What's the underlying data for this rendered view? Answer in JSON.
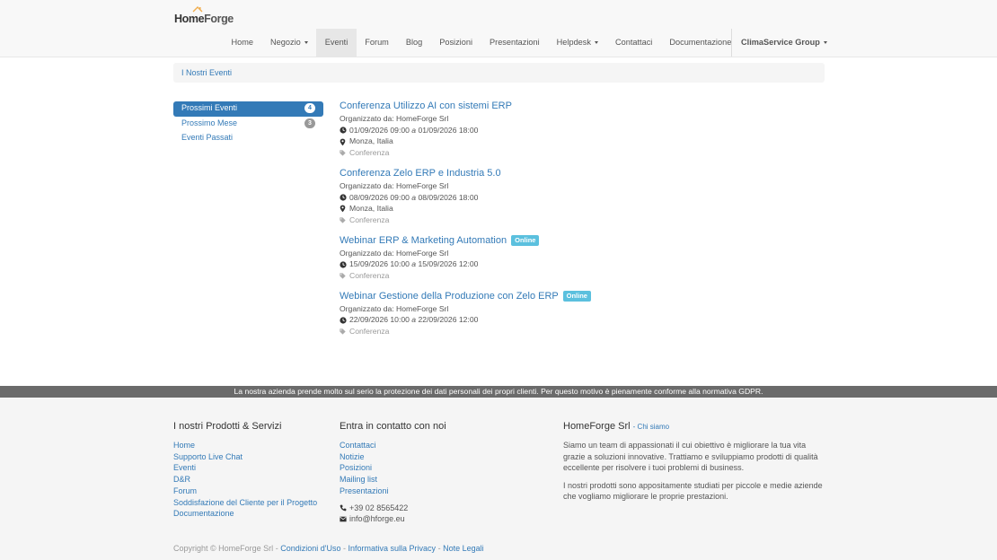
{
  "header": {
    "brand": {
      "home": "Home",
      "forge": "Forge"
    },
    "nav": [
      {
        "label": "Home",
        "dropdown": false,
        "active": false
      },
      {
        "label": "Negozio",
        "dropdown": true,
        "active": false
      },
      {
        "label": "Eventi",
        "dropdown": false,
        "active": true
      },
      {
        "label": "Forum",
        "dropdown": false,
        "active": false
      },
      {
        "label": "Blog",
        "dropdown": false,
        "active": false
      },
      {
        "label": "Posizioni",
        "dropdown": false,
        "active": false
      },
      {
        "label": "Presentazioni",
        "dropdown": false,
        "active": false
      },
      {
        "label": "Helpdesk",
        "dropdown": true,
        "active": false
      },
      {
        "label": "Contattaci",
        "dropdown": false,
        "active": false
      },
      {
        "label": "Documentazione",
        "dropdown": false,
        "active": false
      }
    ],
    "company": "ClimaService Group"
  },
  "breadcrumb": "I Nostri Eventi",
  "sidebar": [
    {
      "label": "Prossimi Eventi",
      "count": "4",
      "active": true
    },
    {
      "label": "Prossimo Mese",
      "count": "3",
      "active": false
    },
    {
      "label": "Eventi Passati",
      "count": "",
      "active": false
    }
  ],
  "events": [
    {
      "title": "Conferenza Utilizzo AI con sistemi ERP",
      "online": false,
      "organizer": "Organizzato da: HomeForge Srl",
      "start": "01/09/2026 09:00",
      "end": "01/09/2026 18:00",
      "location": "Monza, Italia",
      "tag": "Conferenza"
    },
    {
      "title": "Conferenza Zelo ERP e Industria 5.0",
      "online": false,
      "organizer": "Organizzato da: HomeForge Srl",
      "start": "08/09/2026 09:00",
      "end": "08/09/2026 18:00",
      "location": "Monza, Italia",
      "tag": "Conferenza"
    },
    {
      "title": "Webinar ERP & Marketing Automation",
      "online": true,
      "organizer": "Organizzato da: HomeForge Srl",
      "start": "15/09/2026 10:00",
      "end": "15/09/2026 12:00",
      "location": "",
      "tag": "Conferenza"
    },
    {
      "title": "Webinar Gestione della Produzione con Zelo ERP",
      "online": true,
      "organizer": "Organizzato da: HomeForge Srl",
      "start": "22/09/2026 10:00",
      "end": "22/09/2026 12:00",
      "location": "",
      "tag": "Conferenza"
    }
  ],
  "labels": {
    "online": "Online",
    "date_sep": "a"
  },
  "gdpr": "La nostra azienda prende molto sul serio la protezione dei dati personali dei propri clienti. Per questo motivo è pienamente conforme alla normativa GDPR.",
  "footer": {
    "products": {
      "title": "I nostri Prodotti & Servizi",
      "links": [
        "Home",
        "Supporto Live Chat",
        "Eventi",
        "D&R",
        "Forum",
        "Soddisfazione del Cliente per il Progetto",
        "Documentazione"
      ]
    },
    "contact": {
      "title": "Entra in contatto con noi",
      "links": [
        "Contattaci",
        "Notizie",
        "Posizioni",
        "Mailing list",
        "Presentazioni"
      ],
      "phone": "+39 02 8565422",
      "email": "info@hforge.eu"
    },
    "about": {
      "title": "HomeForge Srl",
      "link": "Chi siamo",
      "sep": "-",
      "p1": "Siamo un team di appassionati il cui obiettivo è migliorare la tua vita grazie a soluzioni innovative. Trattiamo e sviluppiamo prodotti di qualità eccellente per risolvere i tuoi problemi di business.",
      "p2": "I nostri prodotti sono appositamente studiati per piccole e medie aziende che vogliamo migliorare le proprie prestazioni."
    },
    "copyright": "Copyright © HomeForge Srl",
    "sep": "-",
    "legal": [
      "Condizioni d'Uso",
      "Informativa sulla Privacy",
      "Note Legali"
    ]
  },
  "colors": {
    "link": "#337ab7",
    "online_badge": "#5bc0de",
    "gdpr_bar": "#6b6b6b",
    "brand_roof": "#f0ad4e"
  }
}
